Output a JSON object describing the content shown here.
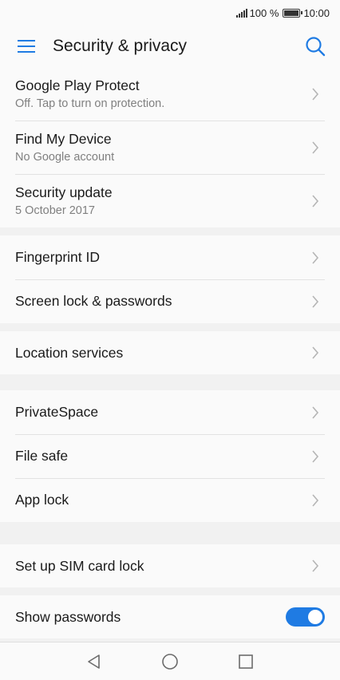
{
  "status_bar": {
    "battery": "100 %",
    "time": "10:00"
  },
  "app_bar": {
    "title": "Security & privacy",
    "menu_icon": "hamburger-icon",
    "search_icon": "search-icon"
  },
  "accent_color": "#1f7be3",
  "groups": [
    {
      "items": [
        {
          "label": "Google Play Protect",
          "sub": "Off. Tap to turn on protection."
        },
        {
          "label": "Find My Device",
          "sub": "No Google account"
        },
        {
          "label": "Security update",
          "sub": "5 October 2017"
        }
      ]
    },
    {
      "items": [
        {
          "label": "Fingerprint ID"
        },
        {
          "label": "Screen lock & passwords"
        }
      ]
    },
    {
      "items": [
        {
          "label": "Location services"
        }
      ]
    },
    {
      "items": [
        {
          "label": "PrivateSpace"
        },
        {
          "label": "File safe"
        },
        {
          "label": "App lock"
        }
      ]
    },
    {
      "items": [
        {
          "label": "Set up SIM card lock"
        }
      ]
    },
    {
      "items": [
        {
          "label": "Show passwords",
          "toggle_on": true
        }
      ]
    }
  ],
  "nav_bar": {
    "back_icon": "back-triangle-icon",
    "home_icon": "home-circle-icon",
    "recents_icon": "recents-square-icon"
  }
}
